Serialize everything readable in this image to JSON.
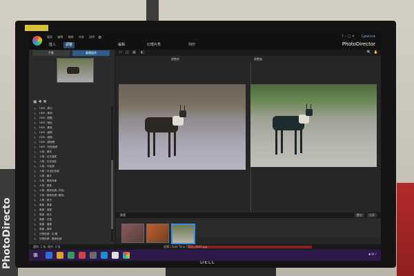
{
  "app": {
    "menu": [
      "檔案",
      "編輯",
      "檢視",
      "外掛",
      "說明"
    ],
    "tabs": [
      "匯入",
      "調整",
      "編輯",
      "幻燈片秀",
      "列印"
    ],
    "active_tab": "調整",
    "product_name": "PhotoDirector",
    "vendor_label": "CyberLink"
  },
  "left_panel": {
    "sub_tabs": [
      "手動",
      "風格組合"
    ],
    "active_sub_tab": "風格組合",
    "presets": [
      "HDR - 夢幻",
      "HDR - 柔和",
      "HDR - 鮮豔",
      "HDR - 暗色",
      "HDR - 暴風",
      "HDR - 細節",
      "HDR - 細微",
      "HDR - 超現實",
      "HDR - 特效強調",
      "人物 - 膚質",
      "人物 - 日光溫柔",
      "人物 - 日光強化",
      "人物 - 冷色調",
      "人物 - 中世紀色調",
      "人物 - 春天",
      "人物 - 柔和肖像",
      "人物 - 柔焦",
      "人物 - 柔和色調 (冷色)",
      "人物 - 柔和色調 (暖色)",
      "人物 - 夏日",
      "風景 - 黃昏",
      "風景 - 湖邊",
      "風景 - 秋天",
      "風景 - 日落",
      "風景 - 溫暖",
      "風景 - 森林",
      "分割色調 - 紅/橙",
      "分割色調 - 藍綠色調",
      "分割色調 - 綠色",
      "分割色調 - 冷色",
      "分割色調 - 柔和色彩",
      "分割色調 - 紅",
      "分割色調 - 橙色",
      "懷舊 - 暗紅",
      "懷舊 - 棕色"
    ],
    "selected_preset_index": 28
  },
  "main": {
    "before_label": "調整前",
    "after_label": "調整後",
    "zoom_label": "縮放: 符合"
  },
  "filmstrip": {
    "left_label": "篩選",
    "right_buttons": [
      "匯出",
      "分享"
    ]
  },
  "status": {
    "left_text": "選取: 1 張, 總共: 3 張",
    "file_text": "相簿 | Split Tone / DSC_0842.jpg"
  },
  "monitor": {
    "brand": "DELL"
  },
  "environment": {
    "box_text": "PhotoDirecto"
  }
}
